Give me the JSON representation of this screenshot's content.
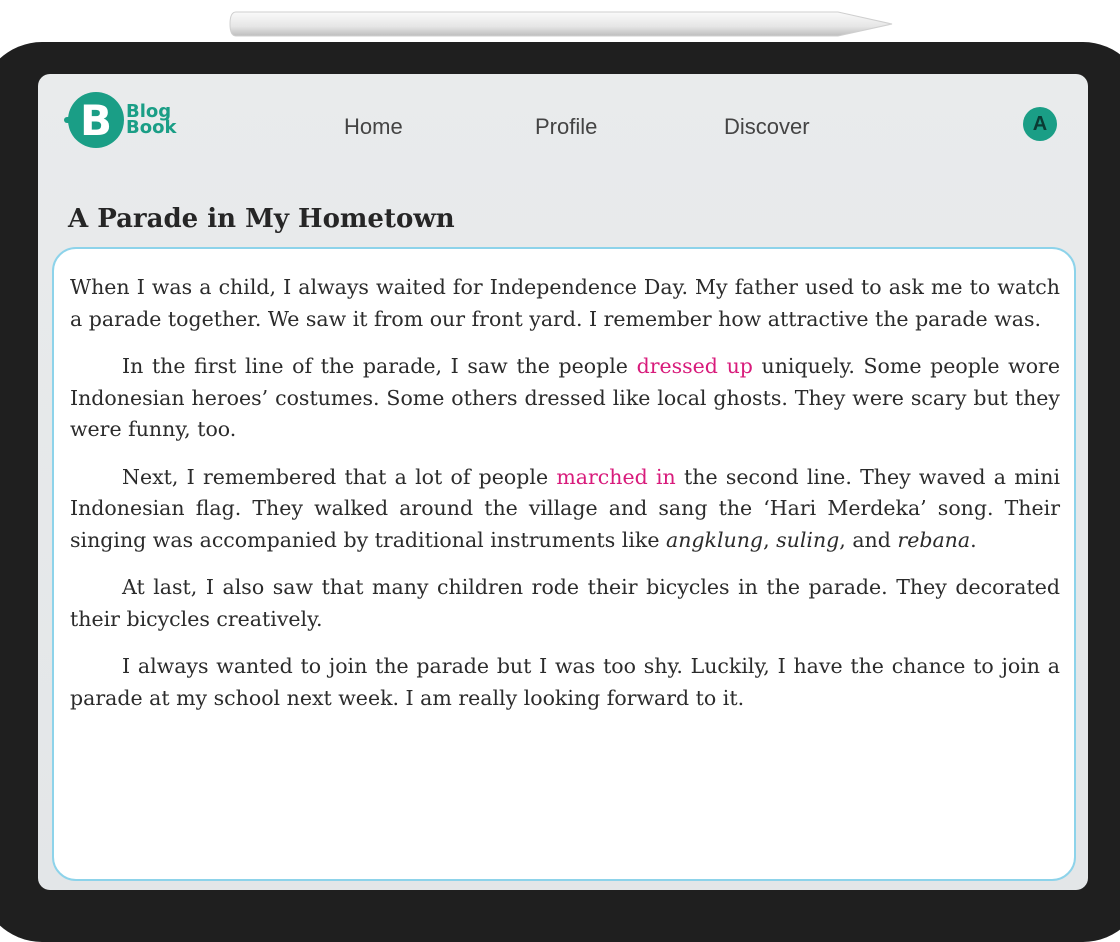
{
  "logo": {
    "mark": "B",
    "line1": "Blog",
    "line2": "Book"
  },
  "nav": {
    "home": "Home",
    "profile": "Profile",
    "discover": "Discover"
  },
  "avatar": {
    "initial": "A"
  },
  "article": {
    "title": "A Parade in My Hometown",
    "p1": "When I was a child, I always waited for Independence Day. My father used to ask me to watch a parade together. We saw it from our front yard. I remember how attractive the parade was.",
    "p2_before": "In the first line of the parade, I saw the people ",
    "p2_highlight": "dressed up",
    "p2_after": " uniquely. Some people wore Indonesian heroes’ costumes. Some others dressed like local ghosts. They were scary but they were funny, too.",
    "p3_before": "Next, I remembered that a lot of people ",
    "p3_highlight": "marched in",
    "p3_mid": " the second line. They waved a mini Indonesian flag. They walked around the village and sang the ‘Hari Merdeka’ song. Their singing was accompanied by traditional instruments like ",
    "p3_inst1": "angklung",
    "p3_sep1": ", ",
    "p3_inst2": "suling",
    "p3_sep2": ", and ",
    "p3_inst3": "rebana",
    "p3_end": ".",
    "p4": "At last, I also saw that many children rode their bicycles in the parade. They decorated their bicycles creatively.",
    "p5": "I always wanted to join the parade but I was too shy. Luckily, I have the chance to join a parade at my school next week. I am really looking forward to it."
  },
  "colors": {
    "brand": "#1a9e86",
    "highlight": "#d81b7b",
    "card_border": "#8dd3ea"
  }
}
